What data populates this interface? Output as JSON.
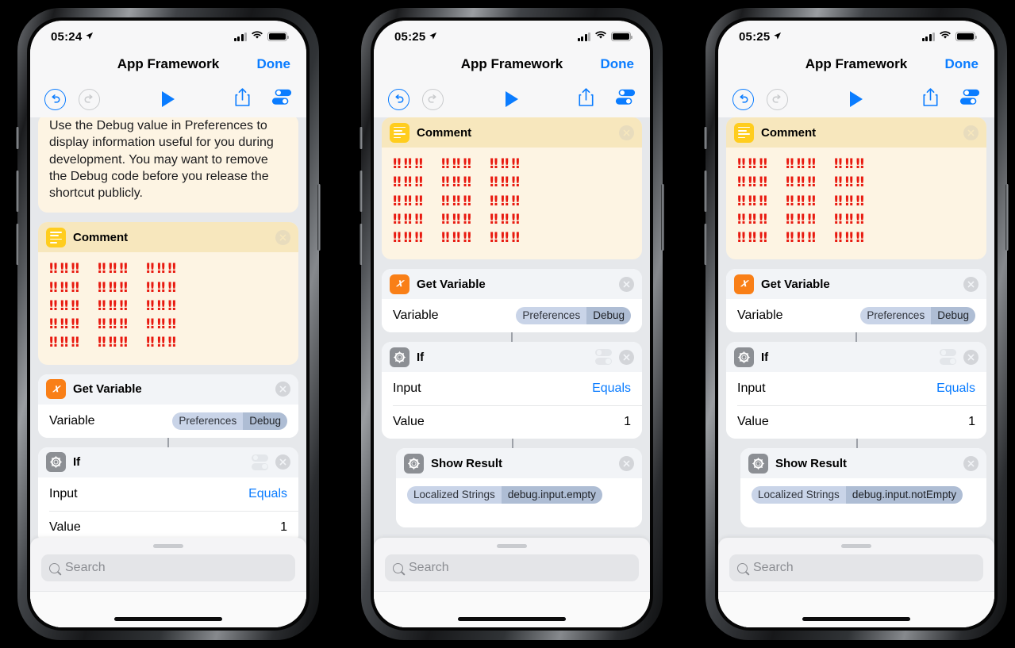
{
  "app": {
    "nav_title": "App Framework",
    "done_label": "Done",
    "search_placeholder": "Search"
  },
  "icons": {
    "undo": "↺",
    "redo": "↻",
    "play": "play-icon",
    "share": "share-icon",
    "settings": "sliders-icon",
    "gear": "⚙",
    "variable": "𝑥",
    "close": "✕"
  },
  "phones": [
    {
      "status": {
        "time": "05:24",
        "location_arrow": "➤",
        "signal": "signal-bars",
        "wifi": "wifi",
        "battery": "battery-full"
      },
      "blocks": [
        {
          "kind": "note",
          "text": "Use the Debug value in Preferences to display information useful for you during development. You may want to remove the Debug code before you release the shortcut publicly."
        },
        {
          "kind": "comment",
          "title": "Comment",
          "rows": 5,
          "groups": 3,
          "per_group": 3,
          "glyph": "‼"
        },
        {
          "kind": "action",
          "title": "Get Variable",
          "icon": "variable",
          "params": [
            {
              "label": "Variable",
              "type": "pill",
              "pill_left": "Preferences",
              "pill_right": "Debug"
            }
          ]
        },
        {
          "kind": "action",
          "title": "If",
          "icon": "gear",
          "has_sliders": true,
          "params": [
            {
              "label": "Input",
              "type": "link",
              "value": "Equals"
            },
            {
              "label": "Value",
              "type": "text",
              "value": "1"
            }
          ]
        }
      ]
    },
    {
      "status": {
        "time": "05:25",
        "location_arrow": "➤",
        "signal": "signal-bars",
        "wifi": "wifi",
        "battery": "battery-full"
      },
      "blocks": [
        {
          "kind": "comment",
          "title": "Comment",
          "rows": 5,
          "groups": 3,
          "per_group": 3,
          "glyph": "‼"
        },
        {
          "kind": "action",
          "title": "Get Variable",
          "icon": "variable",
          "params": [
            {
              "label": "Variable",
              "type": "pill",
              "pill_left": "Preferences",
              "pill_right": "Debug"
            }
          ]
        },
        {
          "kind": "action",
          "title": "If",
          "icon": "gear",
          "has_sliders": true,
          "params": [
            {
              "label": "Input",
              "type": "link",
              "value": "Equals"
            },
            {
              "label": "Value",
              "type": "text",
              "value": "1"
            }
          ]
        },
        {
          "kind": "action",
          "title": "Show Result",
          "icon": "gear",
          "indented": true,
          "params": [
            {
              "label": "",
              "type": "pill_only",
              "pill_left": "Localized Strings",
              "pill_right": "debug.input.empty"
            }
          ]
        }
      ]
    },
    {
      "status": {
        "time": "05:25",
        "location_arrow": "➤",
        "signal": "signal-bars",
        "wifi": "wifi",
        "battery": "battery-full"
      },
      "blocks": [
        {
          "kind": "comment",
          "title": "Comment",
          "rows": 5,
          "groups": 3,
          "per_group": 3,
          "glyph": "‼"
        },
        {
          "kind": "action",
          "title": "Get Variable",
          "icon": "variable",
          "params": [
            {
              "label": "Variable",
              "type": "pill",
              "pill_left": "Preferences",
              "pill_right": "Debug"
            }
          ]
        },
        {
          "kind": "action",
          "title": "If",
          "icon": "gear",
          "has_sliders": true,
          "params": [
            {
              "label": "Input",
              "type": "link",
              "value": "Equals"
            },
            {
              "label": "Value",
              "type": "text",
              "value": "1"
            }
          ]
        },
        {
          "kind": "action",
          "title": "Show Result",
          "icon": "gear",
          "indented": true,
          "params": [
            {
              "label": "",
              "type": "pill_only",
              "pill_left": "Localized Strings",
              "pill_right": "debug.input.notEmpty"
            }
          ]
        }
      ]
    }
  ],
  "colors": {
    "accent_blue": "#0a7cff",
    "comment_yellow": "#ffcd1e",
    "comment_bg": "#fdf4e3",
    "variable_orange": "#f97f17",
    "gear_gray": "#8c8f94",
    "bang_red": "#e8190f",
    "pill_light": "#c9d4e8",
    "pill_dark": "#aebdd4"
  }
}
